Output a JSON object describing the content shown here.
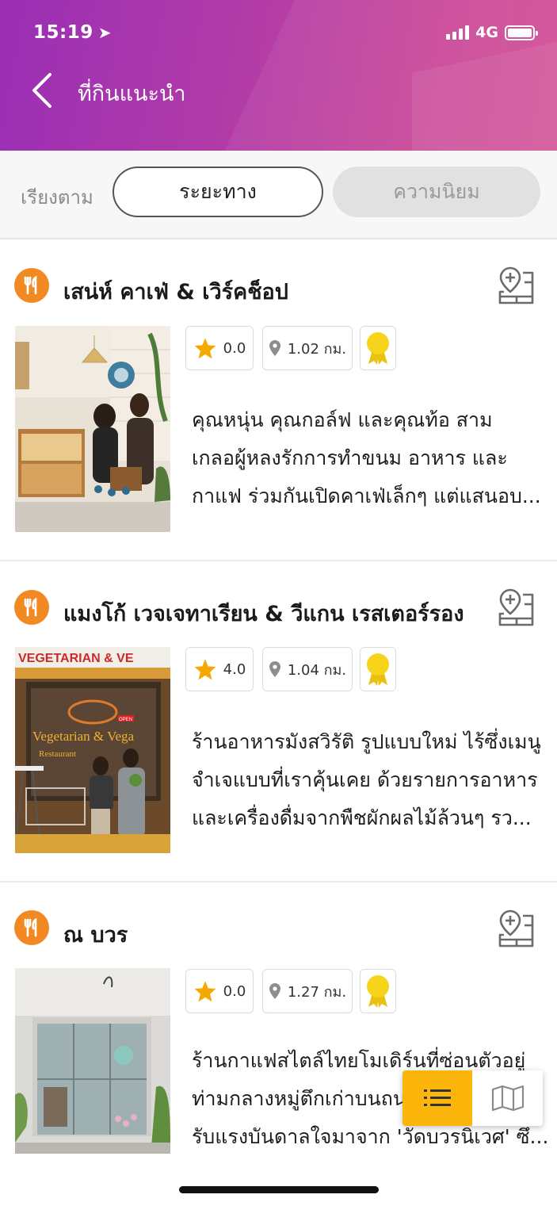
{
  "status_bar": {
    "time": "15:19",
    "network": "4G",
    "location_icon": "location-arrow-icon",
    "signal_icon": "signal-bars-icon",
    "battery_icon": "battery-icon"
  },
  "header": {
    "title": "ที่กินแนะนำ",
    "back_icon": "chevron-left-icon",
    "gradient_start": "#9a2fb5",
    "gradient_end": "#d24f94"
  },
  "sort": {
    "label": "เรียงตาม",
    "options": [
      "ระยะทาง",
      "ความนิยม"
    ],
    "selected": "ระยะทาง"
  },
  "restaurants": [
    {
      "name": "เสน่ห์ คาเฟ่ & เวิร์คช็อป",
      "rating": "0.0",
      "distance": "1.02 กม.",
      "description": [
        "คุณหนุ่น คุณกอล์ฟ และคุณท้อ สาม",
        "เกลอผู้หลงรักการทำขนม อาหาร และ",
        "กาแฟ ร่วมกันเปิดคาเฟ่เล็กๆ แต่แสนอบ..."
      ]
    },
    {
      "name": "แมงโก้ เวจเจทาเรียน & วีแกน เรสเตอร์รอง",
      "rating": "4.0",
      "distance": "1.04 กม.",
      "description": [
        "ร้านอาหารมังสวิรัติ รูปแบบใหม่ ไร้ซึ่งเมนู",
        "จำเจแบบที่เราคุ้นเคย ด้วยรายการอาหาร",
        "และเครื่องดื่มจากพืชผักผลไม้ล้วนๆ รว..."
      ],
      "photo_sign_text": [
        "VEGETARIAN & VE",
        "Vegetarian & Vega",
        "Restaurant",
        "OPEN"
      ]
    },
    {
      "name": "ณ บวร",
      "rating": "0.0",
      "distance": "1.27 กม.",
      "description": [
        "ร้านกาแฟสไตล์ไทยโมเดิร์นที่ซ่อนตัวอยู่",
        "ท่ามกลางหมู่ตึกเก่าบนถนนพระสุเมรุ ได้",
        "รับแรงบันดาลใจมาจาก 'วัดบวรนิเวศ' ซึ..."
      ]
    }
  ],
  "view_toggle": {
    "list_icon": "list-icon",
    "map_icon": "map-icon",
    "active": "list",
    "active_color": "#fbb50b"
  },
  "colors": {
    "accent_orange": "#f28a24",
    "star": "#f5a800",
    "award": "#f7d41c"
  }
}
